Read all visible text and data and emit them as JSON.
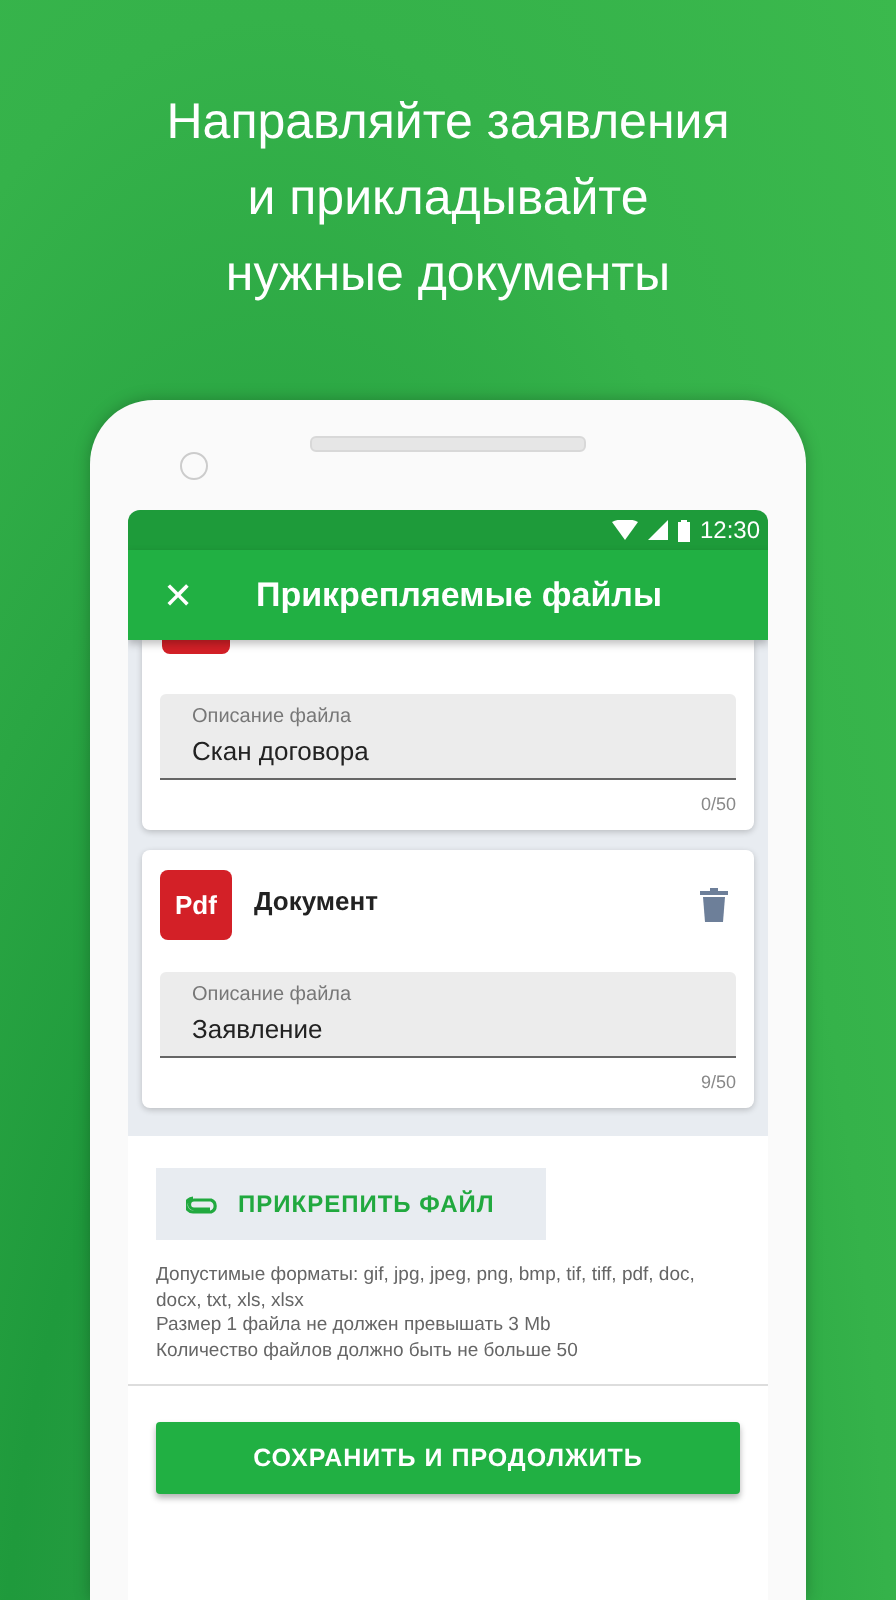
{
  "headline": [
    "Направляйте заявления",
    "и прикладывайте",
    "нужные документы"
  ],
  "status_bar": {
    "time": "12:30"
  },
  "toolbar": {
    "close": "✕",
    "title": "Прикрепляемые файлы"
  },
  "files": [
    {
      "kind": "clipped",
      "field_label": "Описание файла",
      "value": "Скан договора",
      "counter": "0/50"
    },
    {
      "kind": "full",
      "badge": "Pdf",
      "name": "Документ",
      "field_label": "Описание файла",
      "value": "Заявление",
      "counter": "9/50"
    }
  ],
  "attach_button": "ПРИКРЕПИТЬ ФАЙЛ",
  "hints": [
    "Допустимые форматы: gif, jpg, jpeg, png, bmp, tif, tiff, pdf, doc, docx, txt, xls, xlsx",
    "Размер 1 файла не должен превышать 3 Mb",
    "Количество файлов должно быть не больше 50"
  ],
  "save_button": "СОХРАНИТЬ И ПРОДОЛЖИТЬ"
}
